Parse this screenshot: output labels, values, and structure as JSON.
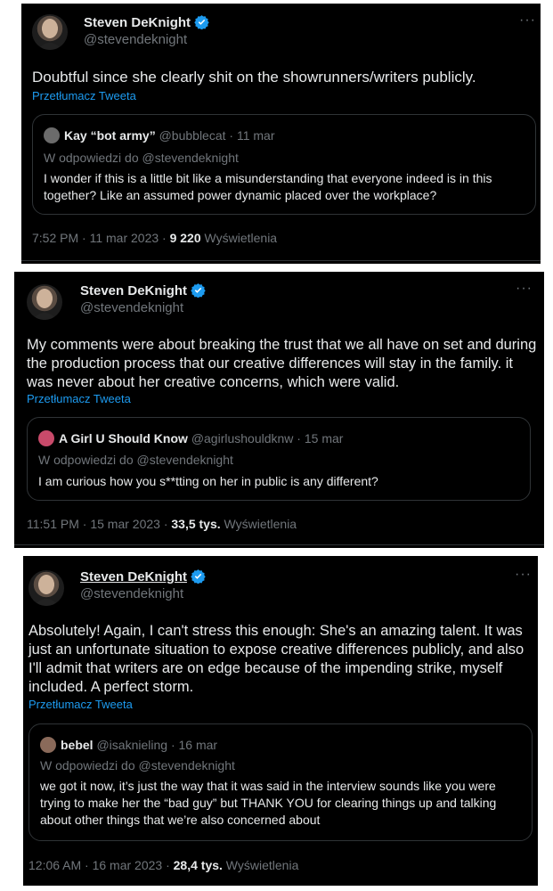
{
  "tweets": [
    {
      "author_name": "Steven DeKnight",
      "author_handle": "@stevendeknight",
      "text": "Doubtful since she clearly shit on the showrunners/writers publicly.",
      "translate": "Przetłumacz Tweeta",
      "quote": {
        "name": "Kay “bot army”",
        "meta": "@bubblecat · 11 mar",
        "reply_to": "W odpowiedzi do @stevendeknight",
        "text": "I wonder if this is a little bit like a misunderstanding that everyone indeed is in this together? Like an assumed power dynamic placed over the workplace?",
        "avatar_color": "#6b6b6b"
      },
      "time": "7:52 PM · 11 mar 2023 · ",
      "views": "9 220",
      "views_label": " Wyświetlenia"
    },
    {
      "author_name": "Steven DeKnight",
      "author_handle": "@stevendeknight",
      "text": "My comments were about breaking the trust that we all have on set and during the production process that our creative differences will stay in the family. it was never about her creative concerns, which were valid.",
      "translate": "Przetłumacz Tweeta",
      "quote": {
        "name": "A Girl U Should Know",
        "meta": "@agirlushouldknw · 15 mar",
        "reply_to": "W odpowiedzi do @stevendeknight",
        "text": "I am curious how you s**tting on her in public is any different?",
        "avatar_color": "#c84a6a"
      },
      "time": "11:51 PM · 15 mar 2023 · ",
      "views": "33,5 tys.",
      "views_label": " Wyświetlenia"
    },
    {
      "author_name": "Steven DeKnight",
      "author_handle": "@stevendeknight",
      "text": "Absolutely! Again, I can't stress this enough: She's an amazing talent. It was just an unfortunate situation to expose creative differences publicly, and also I'll admit that writers are on edge because of the impending strike, myself included. A perfect storm.",
      "translate": "Przetłumacz Tweeta",
      "quote": {
        "name": "bebel",
        "meta": "@isaknieling · 16 mar",
        "reply_to": "W odpowiedzi do @stevendeknight",
        "text": "we got it now, it’s just the way that it was said in the interview sounds like you were trying to make her the “bad guy” but THANK YOU for clearing things up and talking about other things that we’re also concerned about",
        "avatar_color": "#8a6a5a"
      },
      "time": "12:06 AM · 16 mar 2023 · ",
      "views": "28,4 tys.",
      "views_label": " Wyświetlenia"
    }
  ],
  "colors": {
    "background": "#000000",
    "text": "#e7e9ea",
    "muted": "#71767b",
    "link": "#1d9bf0",
    "border": "#2f3336"
  },
  "icons": {
    "verified": "verified-badge-icon",
    "more": "more-options-icon"
  }
}
